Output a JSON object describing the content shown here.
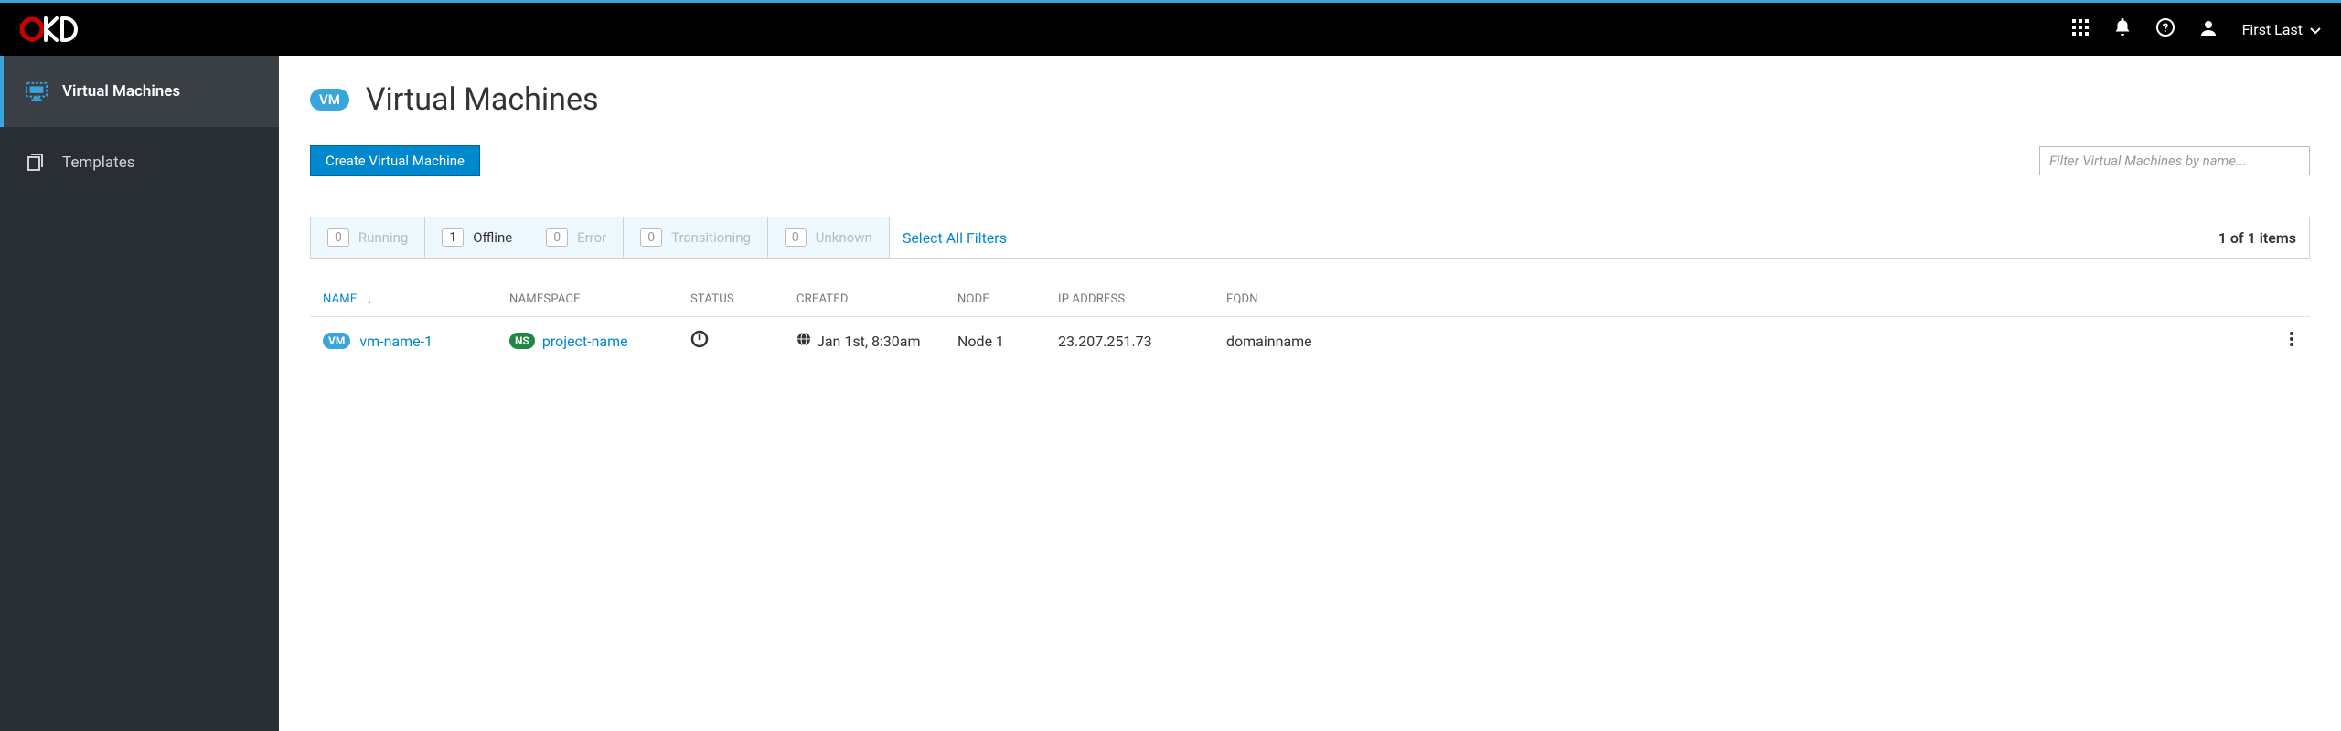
{
  "header": {
    "user_name": "First Last"
  },
  "sidebar": {
    "items": [
      {
        "label": "Virtual Machines",
        "active": true
      },
      {
        "label": "Templates",
        "active": false
      }
    ]
  },
  "page": {
    "badge": "VM",
    "title": "Virtual Machines",
    "create_button": "Create Virtual Machine",
    "filter_placeholder": "Filter Virtual Machines by name..."
  },
  "filters": {
    "tabs": [
      {
        "count": "0",
        "label": "Running",
        "nonzero": false
      },
      {
        "count": "1",
        "label": "Offline",
        "nonzero": true
      },
      {
        "count": "0",
        "label": "Error",
        "nonzero": false
      },
      {
        "count": "0",
        "label": "Transitioning",
        "nonzero": false
      },
      {
        "count": "0",
        "label": "Unknown",
        "nonzero": false
      }
    ],
    "select_all": "Select All Filters",
    "item_count": "1 of 1 items"
  },
  "table": {
    "columns": {
      "name": "NAME",
      "namespace": "NAMESPACE",
      "status": "STATUS",
      "created": "CREATED",
      "node": "NODE",
      "ip": "IP ADDRESS",
      "fqdn": "FQDN"
    },
    "rows": [
      {
        "vm_badge": "VM",
        "name": "vm-name-1",
        "ns_badge": "NS",
        "namespace": "project-name",
        "created": "Jan 1st, 8:30am",
        "node": "Node 1",
        "ip": "23.207.251.73",
        "fqdn": "domainname"
      }
    ]
  }
}
